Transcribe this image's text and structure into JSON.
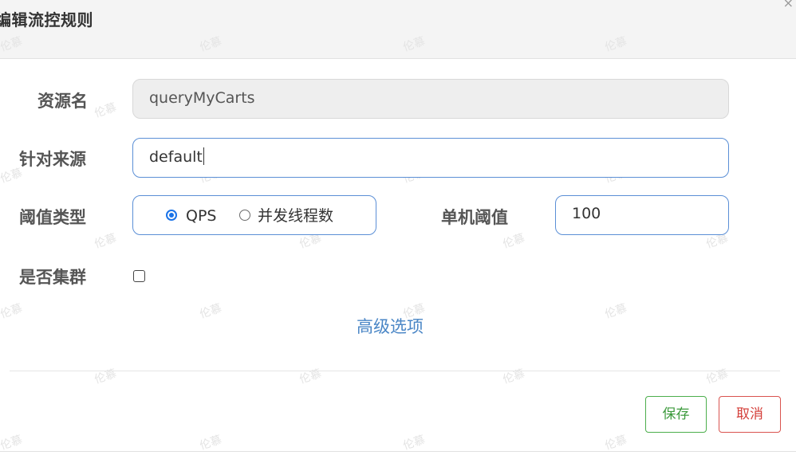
{
  "dialog": {
    "title": "编辑流控规则",
    "close_glyph": "×"
  },
  "form": {
    "resource_label": "资源名",
    "resource_value": "queryMyCarts",
    "origin_label": "针对来源",
    "origin_value": "default",
    "threshold_type_label": "阈值类型",
    "threshold_type_options": [
      {
        "label": "QPS",
        "checked": true
      },
      {
        "label": "并发线程数",
        "checked": false
      }
    ],
    "single_threshold_label": "单机阈值",
    "single_threshold_value": "100",
    "cluster_label": "是否集群",
    "cluster_checked": false,
    "advanced_link": "高级选项"
  },
  "buttons": {
    "save_label": "保存",
    "cancel_label": "取消"
  },
  "watermark": "伦慕",
  "colors": {
    "accent_blue": "#1a73e8",
    "input_border": "#5b8fd6",
    "link": "#4a86c6",
    "save": "#4cae4c",
    "cancel": "#d9534f"
  }
}
